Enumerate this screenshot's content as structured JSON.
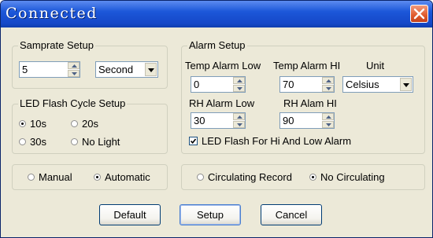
{
  "window": {
    "title": "Connected",
    "close_icon": "close-icon"
  },
  "samprate": {
    "legend": "Samprate Setup",
    "value": "5",
    "unit_selected": "Second"
  },
  "led": {
    "legend": "LED Flash Cycle Setup",
    "options": [
      "10s",
      "20s",
      "30s",
      "No Light"
    ],
    "selected": "10s"
  },
  "alarm": {
    "legend": "Alarm Setup",
    "temp_low_label": "Temp Alarm Low",
    "temp_hi_label": "Temp Alarm HI",
    "unit_label": "Unit",
    "unit_selected": "Celsius",
    "temp_low_value": "0",
    "temp_hi_value": "70",
    "rh_low_label": "RH Alarm Low",
    "rh_hi_label": "RH Alam HI",
    "rh_low_value": "30",
    "rh_hi_value": "90",
    "led_flash_label": "LED Flash For Hi And Low  Alarm",
    "led_flash_checked": true
  },
  "mode": {
    "options": [
      "Manual",
      "Automatic"
    ],
    "selected": "Automatic"
  },
  "record": {
    "options": [
      "Circulating Record",
      "No Circulating"
    ],
    "selected": "No Circulating"
  },
  "buttons": {
    "default": "Default",
    "setup": "Setup",
    "cancel": "Cancel"
  },
  "colors": {
    "titlebar": "#1c57d9",
    "close": "#e05a2c",
    "window_bg": "#ece9d8"
  }
}
